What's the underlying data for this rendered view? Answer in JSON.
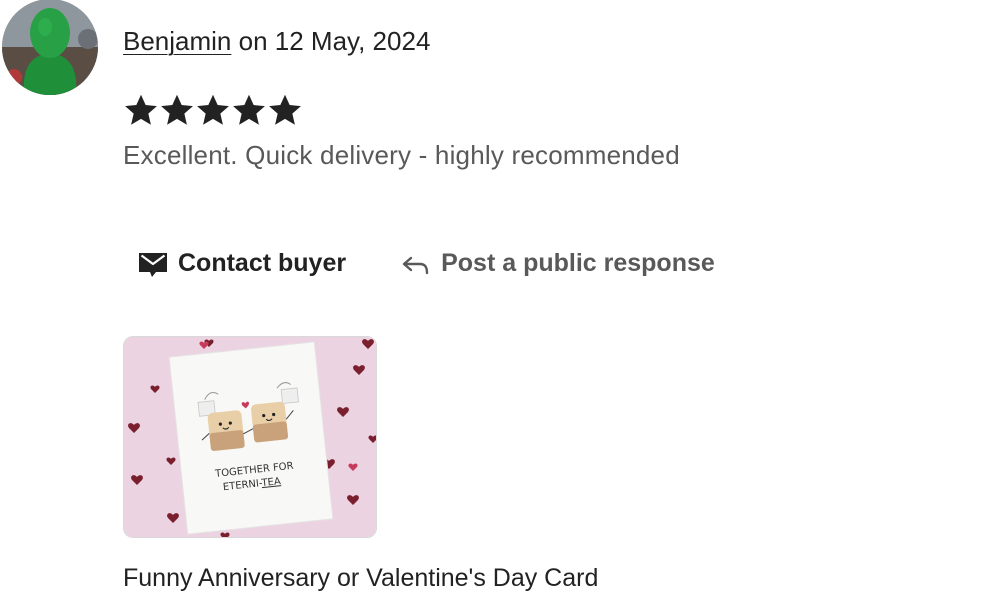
{
  "review": {
    "reviewer_name": "Benjamin",
    "date_prefix": " on ",
    "date": "12 May, 2024",
    "rating": 5,
    "rating_max": 5,
    "text": "Excellent. Quick delivery - highly recommended"
  },
  "actions": {
    "contact_label": "Contact buyer",
    "contact_icon": "envelope-icon",
    "respond_label": "Post a public response",
    "respond_icon": "reply-arrow-icon"
  },
  "product": {
    "title": "Funny Anniversary or Valentine's Day Card",
    "card_line1": "TOGETHER FOR",
    "card_line2_prefix": "ETERNI-",
    "card_line2_emph": "TEA",
    "background_color": "#ecd3e2",
    "heart_color": "#7a1f2e"
  },
  "colors": {
    "text_primary": "#222222",
    "text_secondary": "#595959",
    "avatar_green": "#1f8f3a"
  }
}
